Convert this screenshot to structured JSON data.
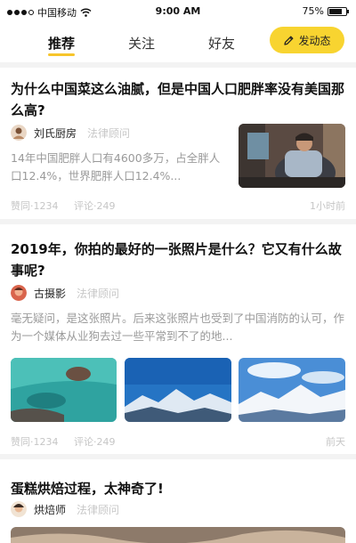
{
  "status_bar": {
    "carrier": "中国移动",
    "time": "9:00 AM",
    "battery": "75%",
    "battery_level": 0.75
  },
  "tabs": [
    {
      "label": "推荐",
      "active": true
    },
    {
      "label": "关注",
      "active": false
    },
    {
      "label": "好友",
      "active": false
    }
  ],
  "post_button": {
    "label": "发动态",
    "icon": "pencil-icon"
  },
  "articles": [
    {
      "title": "为什么中国菜这么油腻，但是中国人口肥胖率没有美国那么高?",
      "author": "刘氏厨房",
      "tag": "法律顾问",
      "snippet": "14年中国肥胖人口有4600多万，占全胖人口12.4%，世界肥胖人口12.4%...",
      "likes": "赞同·1234",
      "comments": "评论·249",
      "time": "1小时前"
    },
    {
      "title": "2019年，你拍的最好的一张照片是什么？它又有什么故事呢?",
      "author": "古摄影",
      "tag": "法律顾问",
      "snippet": "毫无疑问，是这张照片。后来这张照片也受到了中国消防的认可，作为一个媒体从业狗去过一些平常到不了的地...",
      "likes": "赞同·1234",
      "comments": "评论·249",
      "time": "前天"
    },
    {
      "title": "蛋糕烘焙过程，太神奇了!",
      "author": "烘焙师",
      "tag": "法律顾问"
    }
  ],
  "colors": {
    "accent": "#f8d430",
    "underline": "#f7c52c",
    "muted_text": "#9a9a9a",
    "meta_text": "#c6c6c6"
  }
}
